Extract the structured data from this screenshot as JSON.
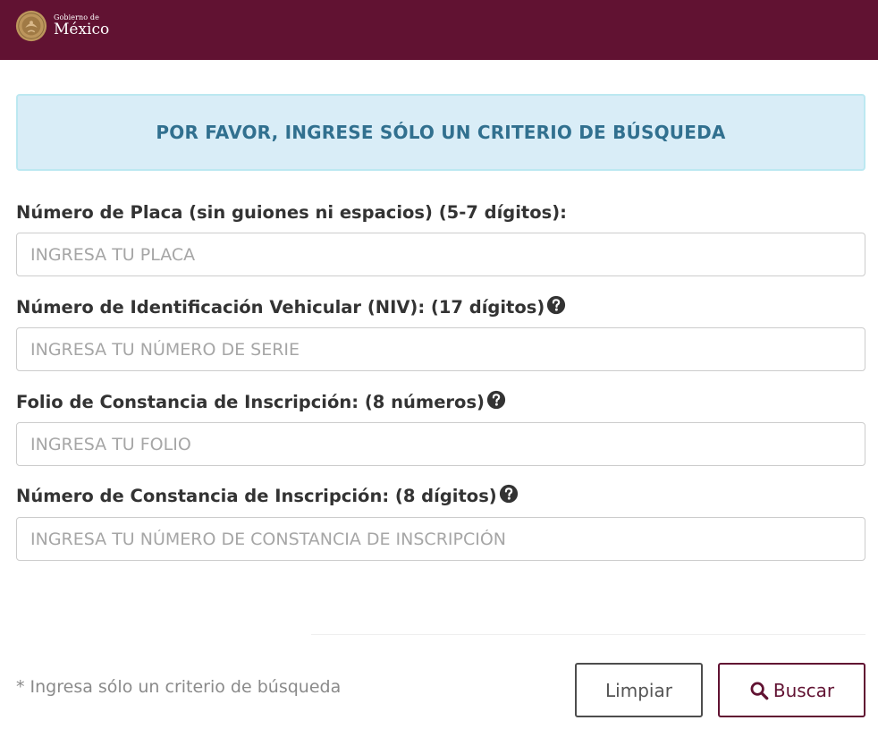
{
  "header": {
    "logo_line1": "Gobierno de",
    "logo_line2": "México"
  },
  "alert": {
    "text": "POR FAVOR, INGRESE SÓLO UN CRITERIO DE BÚSQUEDA"
  },
  "fields": [
    {
      "label": "Número de Placa (sin guiones ni espacios) (5-7 dígitos):",
      "placeholder": "INGRESA TU PLACA",
      "value": "",
      "help_icon": false
    },
    {
      "label": "Número de Identificación Vehicular (NIV): (17 dígitos)",
      "placeholder": "INGRESA TU NÚMERO DE SERIE",
      "value": "",
      "help_icon": true
    },
    {
      "label": "Folio de Constancia de Inscripción: (8 números)",
      "placeholder": "INGRESA TU FOLIO",
      "value": "",
      "help_icon": true
    },
    {
      "label": "Número de Constancia de Inscripción: (8 dígitos)",
      "placeholder": "INGRESA TU NÚMERO DE CONSTANCIA DE INSCRIPCIÓN",
      "value": "",
      "help_icon": true
    }
  ],
  "footer": {
    "note": "* Ingresa sólo un criterio de búsqueda",
    "clear_label": "Limpiar",
    "search_label": "Buscar"
  },
  "icons": {
    "help": "question-circle-icon",
    "search": "search-icon",
    "seal": "coat-of-arms-icon"
  },
  "colors": {
    "header_bg": "#611232",
    "alert_bg": "#d9edf7",
    "alert_text": "#31708f",
    "search_button": "#611232",
    "seal_gold": "#bc955c"
  }
}
